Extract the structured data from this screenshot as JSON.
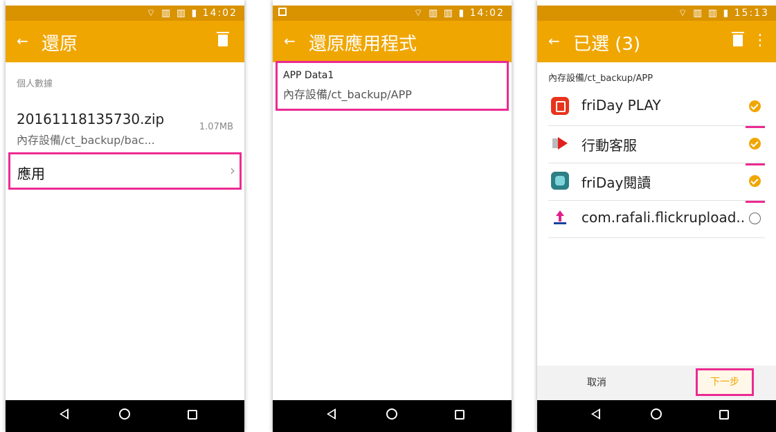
{
  "common": {
    "status_icons": "⌔ ▥ ▥ ▮",
    "back_arrow": "←",
    "accent_color": "#f0a600",
    "highlight_color": "#ec2a92"
  },
  "screen1": {
    "time": "14:02",
    "title": "還原",
    "section_label": "個人數據",
    "file": {
      "name": "20161118135730.zip",
      "path": "內存設備/ct_backup/bac...",
      "size": "1.07MB"
    },
    "apps_label": "應用",
    "chevron": "›"
  },
  "screen2": {
    "time": "14:02",
    "title": "還原應用程式",
    "backup": {
      "name": "APP Data1",
      "path": "內存設備/ct_backup/APP"
    }
  },
  "screen3": {
    "time": "15:13",
    "title": "已選 (3)",
    "more": "⋮",
    "path": "內存設備/ct_backup/APP",
    "apps": [
      {
        "name": "friDay PLAY",
        "icon": "friday-play-icon",
        "checked": true
      },
      {
        "name": "行動客服",
        "icon": "customer-service-icon",
        "checked": true
      },
      {
        "name": "friDay閱讀",
        "icon": "friday-reader-icon",
        "checked": true
      },
      {
        "name": "com.rafali.flickrupload..",
        "icon": "flickr-upload-icon",
        "checked": false
      }
    ],
    "cancel_label": "取消",
    "next_label": "下一步"
  }
}
